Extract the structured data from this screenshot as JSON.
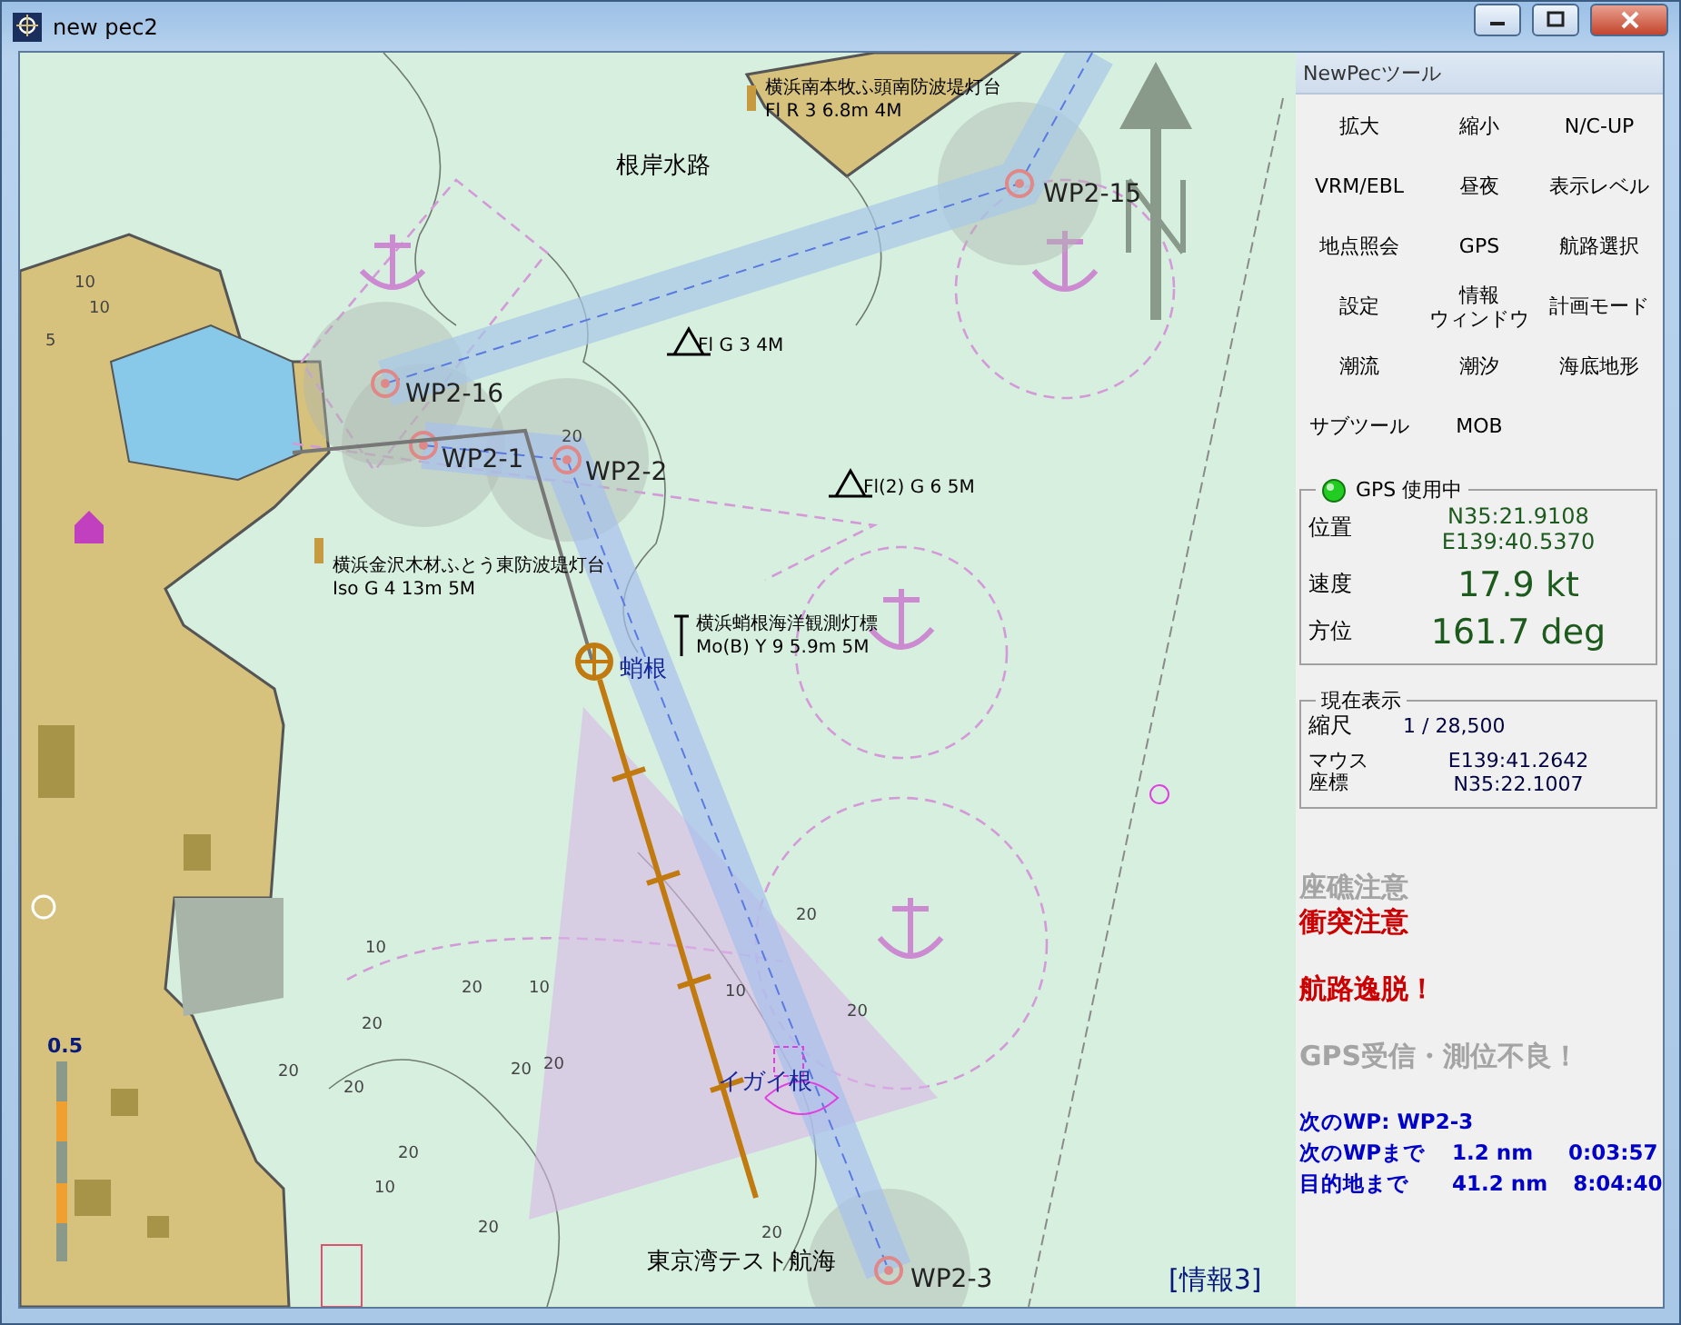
{
  "window": {
    "title": "new pec2"
  },
  "chart": {
    "place_names": [
      {
        "text": "根岸水路",
        "kind": "area"
      },
      {
        "text": "蛸根",
        "kind": "reef"
      },
      {
        "text": "イガイ根",
        "kind": "reef"
      },
      {
        "text": "東京湾テスト航海",
        "kind": "route"
      }
    ],
    "lights": [
      {
        "name": "横浜南本牧ふ頭南防波堤灯台",
        "character": "Fl R 3 6.8m 4M"
      },
      {
        "character": "Fl G 3 4M"
      },
      {
        "character": "Fl(2) G 6 5M"
      },
      {
        "name": "横浜金沢木材ふとう東防波堤灯台",
        "character": "Iso G 4 13m 5M"
      },
      {
        "name": "横浜蛸根海洋観測灯標",
        "character": "Mo(B) Y 9 5.9m 5M"
      }
    ],
    "waypoints": [
      {
        "label": "WP2-15"
      },
      {
        "label": "WP2-16"
      },
      {
        "label": "WP2-1"
      },
      {
        "label": "WP2-2"
      },
      {
        "label": "WP2-3"
      }
    ],
    "soundings": [
      "10",
      "10",
      "5",
      "20",
      "20",
      "10",
      "20",
      "20",
      "20",
      "20",
      "10",
      "20",
      "20",
      "10",
      "20",
      "10",
      "20",
      "20",
      "20"
    ],
    "scale_bar": {
      "label": "0.5"
    },
    "info_tag": "[情報3]"
  },
  "tools": {
    "title": "NewPecツール",
    "buttons": [
      {
        "lines": [
          "拡大"
        ]
      },
      {
        "lines": [
          "縮小"
        ]
      },
      {
        "lines": [
          "N/C-UP"
        ]
      },
      {
        "lines": [
          "VRM/EBL"
        ]
      },
      {
        "lines": [
          "昼夜"
        ]
      },
      {
        "lines": [
          "表示レベル"
        ]
      },
      {
        "lines": [
          "地点照会"
        ]
      },
      {
        "lines": [
          "GPS"
        ]
      },
      {
        "lines": [
          "航路選択"
        ]
      },
      {
        "lines": [
          "設定"
        ]
      },
      {
        "lines": [
          "情報",
          "ウィンドウ"
        ]
      },
      {
        "lines": [
          "計画モード"
        ]
      },
      {
        "lines": [
          "潮流"
        ]
      },
      {
        "lines": [
          "潮汐"
        ]
      },
      {
        "lines": [
          "海底地形"
        ]
      },
      {
        "lines": [
          "サブツール"
        ]
      },
      {
        "lines": [
          "MOB"
        ]
      }
    ]
  },
  "gps": {
    "title": "GPS 使用中",
    "on": true,
    "position_label": "位置",
    "lat": "N35:21.9108",
    "lon": "E139:40.5370",
    "speed_label": "速度",
    "speed": "17.9 kt",
    "heading_label": "方位",
    "heading": "161.7 deg"
  },
  "display": {
    "title": "現在表示",
    "scale_label": "縮尺",
    "scale": "1 / 28,500",
    "mouse_label": [
      "マウス",
      "座標"
    ],
    "mouse_lon": "E139:41.2642",
    "mouse_lat": "N35:22.1007"
  },
  "alerts": [
    {
      "text": "座礁注意",
      "active": false
    },
    {
      "text": "衝突注意",
      "active": true
    },
    {
      "text": "航路逸脱！",
      "active": true
    },
    {
      "text": "GPS受信・測位不良！",
      "active": false
    }
  ],
  "navigation": {
    "next_wp": "次のWP: WP2-3",
    "rows": [
      [
        "次のWPまで",
        "1.2 nm",
        "0:03:57"
      ],
      [
        "目的地まで",
        "41.2 nm",
        "8:04:40"
      ]
    ]
  }
}
